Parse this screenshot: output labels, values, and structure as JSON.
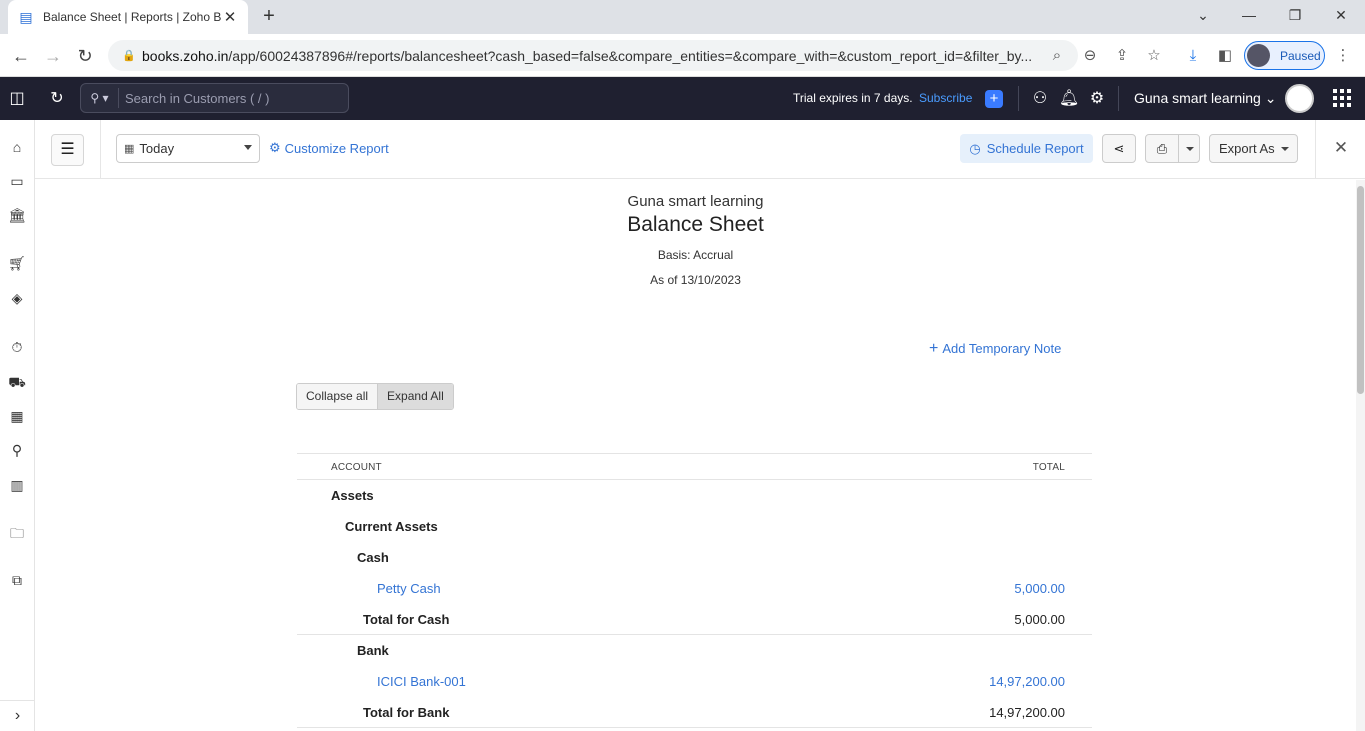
{
  "browser": {
    "tab_title": "Balance Sheet | Reports | Zoho B",
    "url_host": "books.zoho.in",
    "url_path": "/app/60024387896#/reports/balancesheet?cash_based=false&compare_entities=&compare_with=&custom_report_id=&filter_by...",
    "profile_label": "Paused"
  },
  "appbar": {
    "search_placeholder": "Search in Customers ( / )",
    "trial_text": "Trial expires in 7 days.",
    "subscribe_label": "Subscribe",
    "org_name": "Guna smart learning"
  },
  "toolbar": {
    "date_filter": "Today",
    "customize_label": "Customize Report",
    "schedule_label": "Schedule Report",
    "export_label": "Export As"
  },
  "report": {
    "org": "Guna smart learning",
    "title": "Balance Sheet",
    "basis": "Basis: Accrual",
    "as_of": "As of 13/10/2023",
    "add_note_label": "Add Temporary Note",
    "collapse_label": "Collapse all",
    "expand_label": "Expand All",
    "col_account": "ACCOUNT",
    "col_total": "TOTAL",
    "rows": [
      {
        "label": "Assets",
        "amount": "",
        "kind": "bold",
        "indent": 34
      },
      {
        "label": "Current Assets",
        "amount": "",
        "kind": "bold",
        "indent": 48
      },
      {
        "label": "Cash",
        "amount": "",
        "kind": "bold",
        "indent": 60
      },
      {
        "label": "Petty Cash",
        "amount": "5,000.00",
        "kind": "link",
        "indent": 80
      },
      {
        "label": "Total for Cash",
        "amount": "5,000.00",
        "kind": "bold total",
        "indent": 66
      },
      {
        "label": "Bank",
        "amount": "",
        "kind": "bold",
        "indent": 60
      },
      {
        "label": "ICICI Bank-001",
        "amount": "14,97,200.00",
        "kind": "link",
        "indent": 80
      },
      {
        "label": "Total for Bank",
        "amount": "14,97,200.00",
        "kind": "bold total",
        "indent": 66
      }
    ]
  }
}
